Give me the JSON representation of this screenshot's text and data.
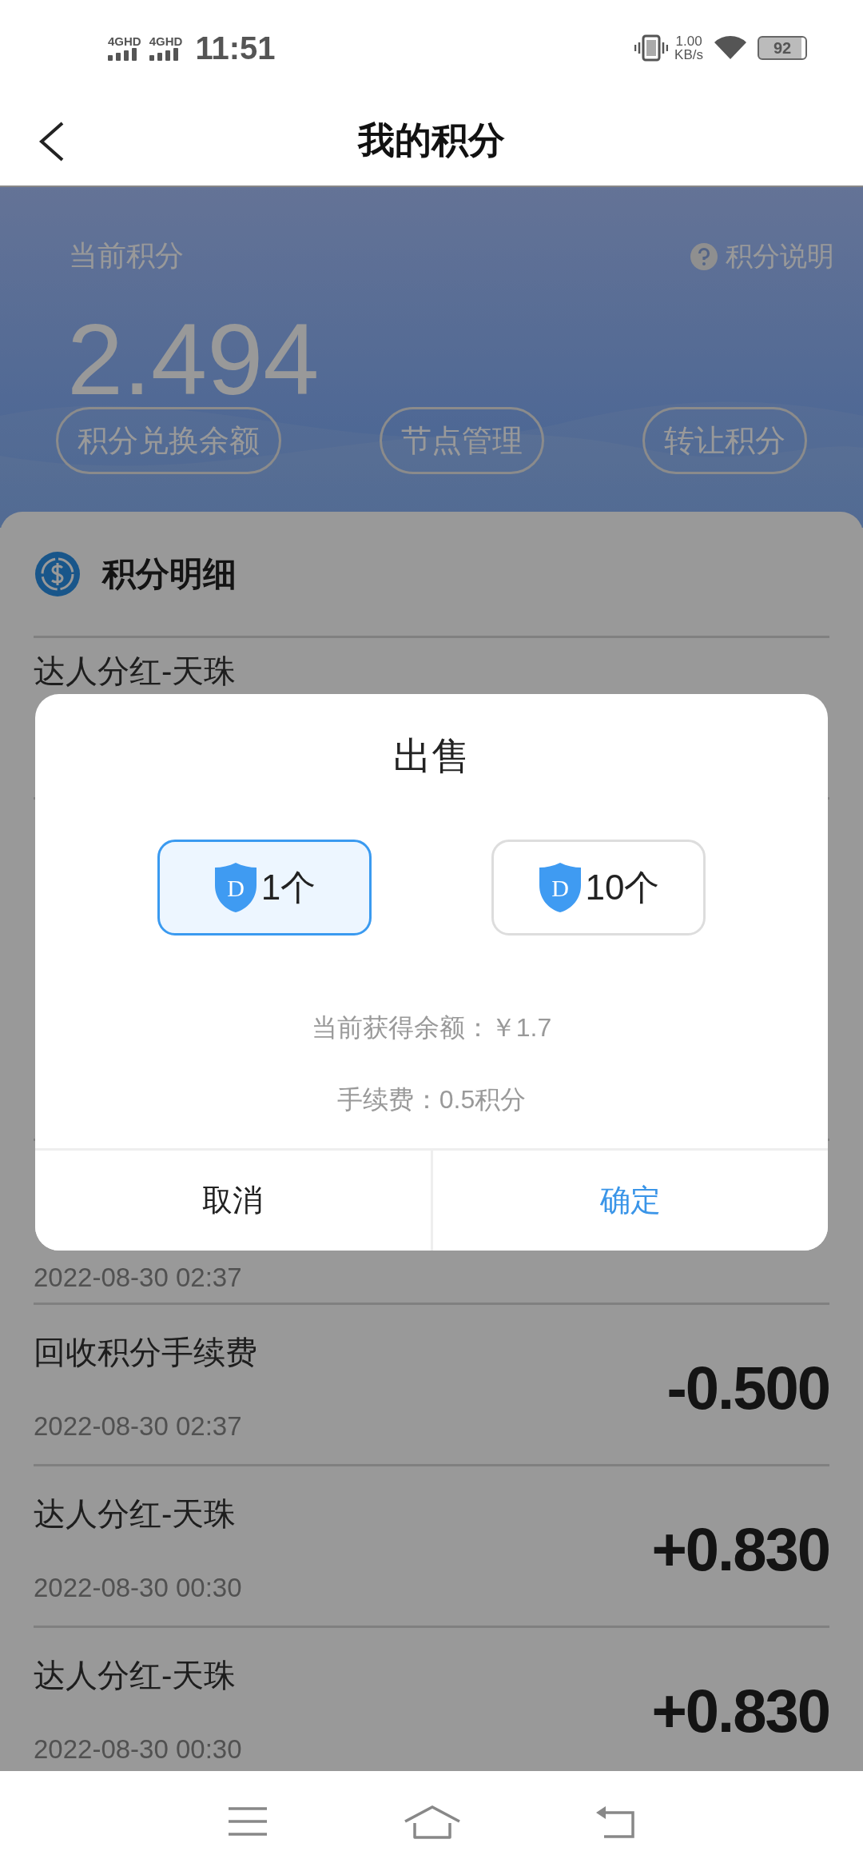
{
  "status_bar": {
    "signals": [
      "4GHD",
      "4GHD"
    ],
    "time": "11:51",
    "speed_value": "1.00",
    "speed_unit": "KB/s",
    "battery": "92"
  },
  "header": {
    "title": "我的积分"
  },
  "banner": {
    "label": "当前积分",
    "help": "积分说明",
    "points": "2.494",
    "actions": [
      "积分兑换余额",
      "节点管理",
      "转让积分"
    ]
  },
  "details": {
    "title": "积分明细",
    "records": [
      {
        "title": "达人分红-天珠"
      },
      {
        "date": "2022-08-30 02:37"
      },
      {
        "title": "回收积分手续费",
        "date": "2022-08-30 02:37",
        "amount": "-0.500"
      },
      {
        "title": "达人分红-天珠",
        "date": "2022-08-30 00:30",
        "amount": "+0.830"
      },
      {
        "title": "达人分红-天珠",
        "date": "2022-08-30 00:30",
        "amount": "+0.830"
      }
    ]
  },
  "dialog": {
    "title": "出售",
    "options": [
      {
        "label": "1个",
        "badge": "D",
        "selected": true
      },
      {
        "label": "10个",
        "badge": "D",
        "selected": false
      }
    ],
    "info": [
      "当前获得余额：￥1.7",
      "手续费：0.5积分"
    ],
    "buttons": [
      {
        "label": "取消",
        "primary": false
      },
      {
        "label": "确定",
        "primary": true
      }
    ]
  }
}
